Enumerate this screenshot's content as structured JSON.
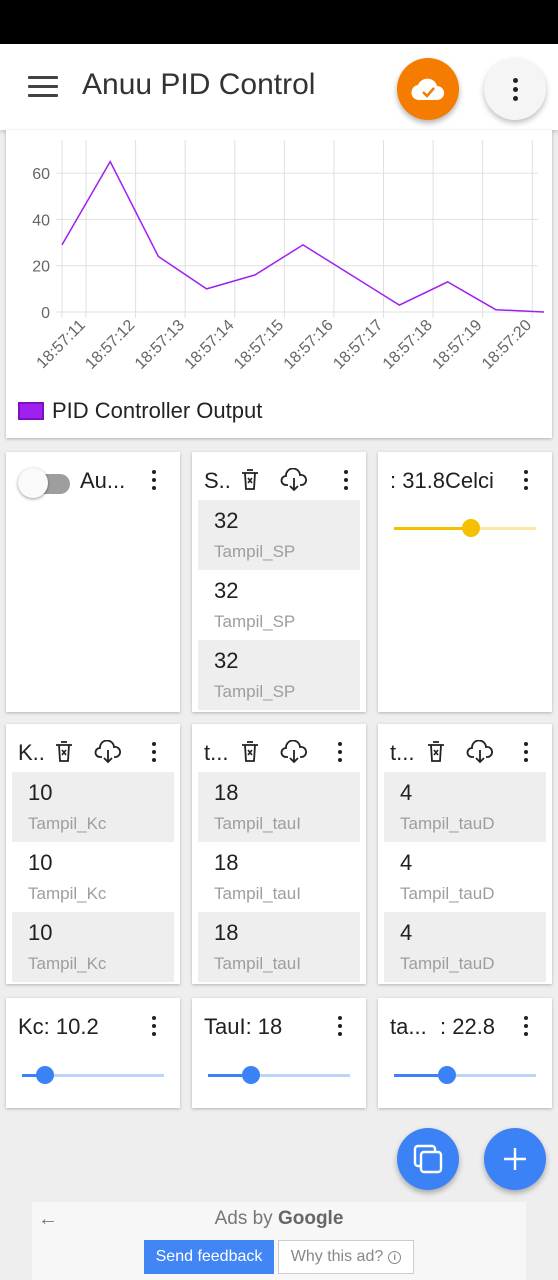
{
  "app": {
    "title": "Anuu PID Control"
  },
  "icons": {
    "menu": "menu-icon",
    "cloud": "cloud-check-icon",
    "more": "more-vert-icon",
    "delete": "delete-box-icon",
    "download": "cloud-download-icon",
    "copy": "copy-icon",
    "add": "plus-icon"
  },
  "colors": {
    "series": "#a020f0",
    "cloud_button": "#f57c00",
    "fab": "#3b82f6",
    "slider_yellow": "#f5c000",
    "slider_blue": "#3b82f6"
  },
  "chart_data": {
    "type": "line",
    "x": [
      "18:57:11",
      "18:57:12",
      "18:57:13",
      "18:57:14",
      "18:57:15",
      "18:57:16",
      "18:57:17",
      "18:57:18",
      "18:57:19",
      "18:57:20"
    ],
    "y_ticks": [
      0,
      20,
      40,
      60
    ],
    "ylim": [
      0,
      70
    ],
    "grid": true,
    "legend_position": "bottom-left",
    "series": [
      {
        "name": "PID Controller Output",
        "values": [
          29,
          65,
          24,
          10,
          16,
          29,
          16,
          3,
          13,
          1,
          0
        ]
      }
    ]
  },
  "widgets": {
    "auto_toggle": {
      "title": "Au...",
      "on": false
    },
    "sp_list": {
      "title": "S..",
      "items": [
        {
          "value": "32",
          "label": "Tampil_SP"
        },
        {
          "value": "32",
          "label": "Tampil_SP"
        },
        {
          "value": "32",
          "label": "Tampil_SP"
        }
      ]
    },
    "temp_slider": {
      "title": ": 31.8Celci",
      "level": 0.54
    },
    "kc_list": {
      "title": "K..",
      "items": [
        {
          "value": "10",
          "label": "Tampil_Kc"
        },
        {
          "value": "10",
          "label": "Tampil_Kc"
        },
        {
          "value": "10",
          "label": "Tampil_Kc"
        }
      ]
    },
    "taui_list": {
      "title": "t...",
      "items": [
        {
          "value": "18",
          "label": "Tampil_tauI"
        },
        {
          "value": "18",
          "label": "Tampil_tauI"
        },
        {
          "value": "18",
          "label": "Tampil_tauI"
        }
      ]
    },
    "taud_list": {
      "title": "t...",
      "items": [
        {
          "value": "4",
          "label": "Tampil_tauD"
        },
        {
          "value": "4",
          "label": "Tampil_tauD"
        },
        {
          "value": "4",
          "label": "Tampil_tauD"
        }
      ]
    },
    "kc_slider": {
      "title": "Kc: 10.2",
      "level": 0.16
    },
    "taui_slider": {
      "title": "TauI: 18",
      "level": 0.3
    },
    "taud_slider": {
      "title_left": "ta...",
      "title_right": ": 22.8",
      "level": 0.37
    }
  },
  "ads": {
    "ads_by": "Ads by",
    "brand": "Google",
    "feedback": "Send feedback",
    "why": "Why this ad?"
  }
}
